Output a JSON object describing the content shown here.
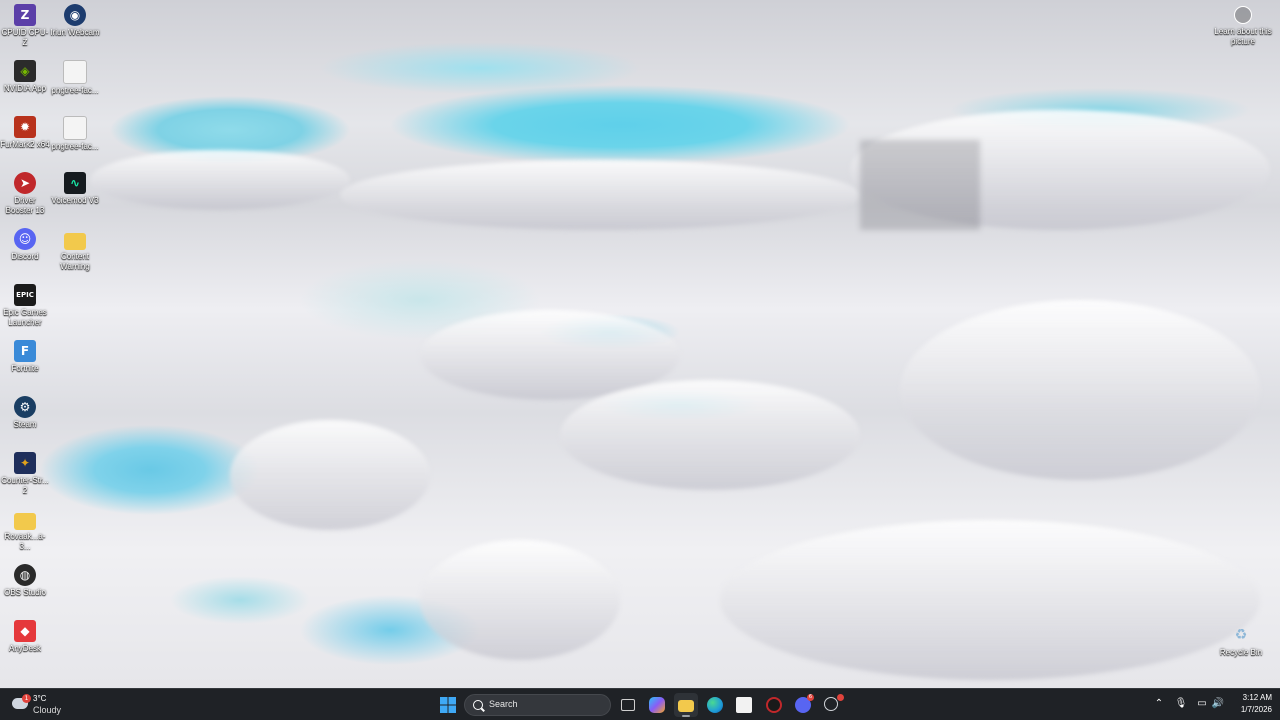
{
  "desktop": {
    "icons": [
      {
        "label": "CPUID CPU-Z",
        "icon": "cpu-z-icon",
        "color": "#5b3fa8"
      },
      {
        "label": "Iriun Webcam",
        "icon": "webcam-icon",
        "color": "#1d3c6e"
      },
      {
        "label": "NVIDIA App",
        "icon": "nvidia-icon",
        "color": "#2b2b2b"
      },
      {
        "label": "pngtree-fac...",
        "icon": "image-file-icon",
        "color": "#f4f4f4"
      },
      {
        "label": "FurMark2 x64",
        "icon": "furmark-icon",
        "color": "#b8321c"
      },
      {
        "label": "pngtree-fac...",
        "icon": "image-file-icon",
        "color": "#f4f4f4"
      },
      {
        "label": "Driver Booster 13",
        "icon": "driver-booster-icon",
        "color": "#c0282b"
      },
      {
        "label": "Voicemod V3",
        "icon": "voicemod-icon",
        "color": "#161b1f"
      },
      {
        "label": "Discord",
        "icon": "discord-icon",
        "color": "#5865f2"
      },
      {
        "label": "Content Warning",
        "icon": "folder-icon",
        "color": "#f2c94c"
      },
      {
        "label": "Epic Games Launcher",
        "icon": "epic-games-icon",
        "color": "#1b1b1b"
      },
      {
        "label": "Fortnite",
        "icon": "fortnite-icon",
        "color": "#3a8ad8"
      },
      {
        "label": "Steam",
        "icon": "steam-icon",
        "color": "#1a3e63"
      },
      {
        "label": "Counter-Str... 2",
        "icon": "counter-strike-icon",
        "color": "#e0a21c"
      },
      {
        "label": "Rovaak...a-3...",
        "icon": "folder-icon",
        "color": "#f2c94c"
      },
      {
        "label": "OBS Studio",
        "icon": "obs-icon",
        "color": "#2a2a2a"
      },
      {
        "label": "AnyDesk",
        "icon": "anydesk-icon",
        "color": "#e5383b"
      },
      {
        "label": "Recycle Bin",
        "icon": "recycle-bin-icon",
        "color": "#8fb8d8"
      }
    ],
    "learn_label": "Learn about this picture"
  },
  "taskbar": {
    "weather": {
      "temp": "3°C",
      "condition": "Cloudy",
      "badge": "1"
    },
    "search_placeholder": "Search",
    "apps": [
      {
        "name": "task-view",
        "icon": "task-view-icon",
        "color": "#cfcfcf"
      },
      {
        "name": "copilot",
        "icon": "copilot-icon",
        "color": "#8a5cf6"
      },
      {
        "name": "file-explorer",
        "icon": "folder-icon",
        "color": "#f2c94c"
      },
      {
        "name": "edge",
        "icon": "edge-icon",
        "color": "#1f9cd8"
      },
      {
        "name": "microsoft-store",
        "icon": "store-icon",
        "color": "#f2f2f2"
      },
      {
        "name": "app-red",
        "icon": "red-app-icon",
        "color": "#c0282b"
      },
      {
        "name": "discord",
        "icon": "discord-icon",
        "color": "#5865f2"
      },
      {
        "name": "steam",
        "icon": "steam-icon",
        "color": "#d0d4d8"
      }
    ],
    "discord_badge": "6",
    "clock": {
      "time": "3:12 AM",
      "date": "1/7/2026"
    }
  }
}
